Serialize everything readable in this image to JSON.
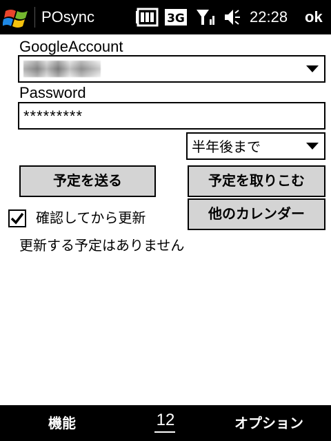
{
  "titlebar": {
    "app_title": "POsync",
    "clock": "22:28",
    "ok_label": "ok",
    "network_label": "3G",
    "icons": [
      "windows-start-icon",
      "battery-icon",
      "3g-icon",
      "signal-icon",
      "volume-icon"
    ]
  },
  "form": {
    "account_label": "GoogleAccount",
    "account_value": "",
    "password_label": "Password",
    "password_value": "*********",
    "period_value": "半年後まで"
  },
  "buttons": {
    "send": "予定を送る",
    "import": "予定を取りこむ",
    "other_calendar": "他のカレンダー"
  },
  "options": {
    "confirm_label": "確認してから更新",
    "confirm_checked": true
  },
  "status_message": "更新する予定はありません",
  "menubar": {
    "left": "機能",
    "center": "12",
    "right": "オプション"
  }
}
